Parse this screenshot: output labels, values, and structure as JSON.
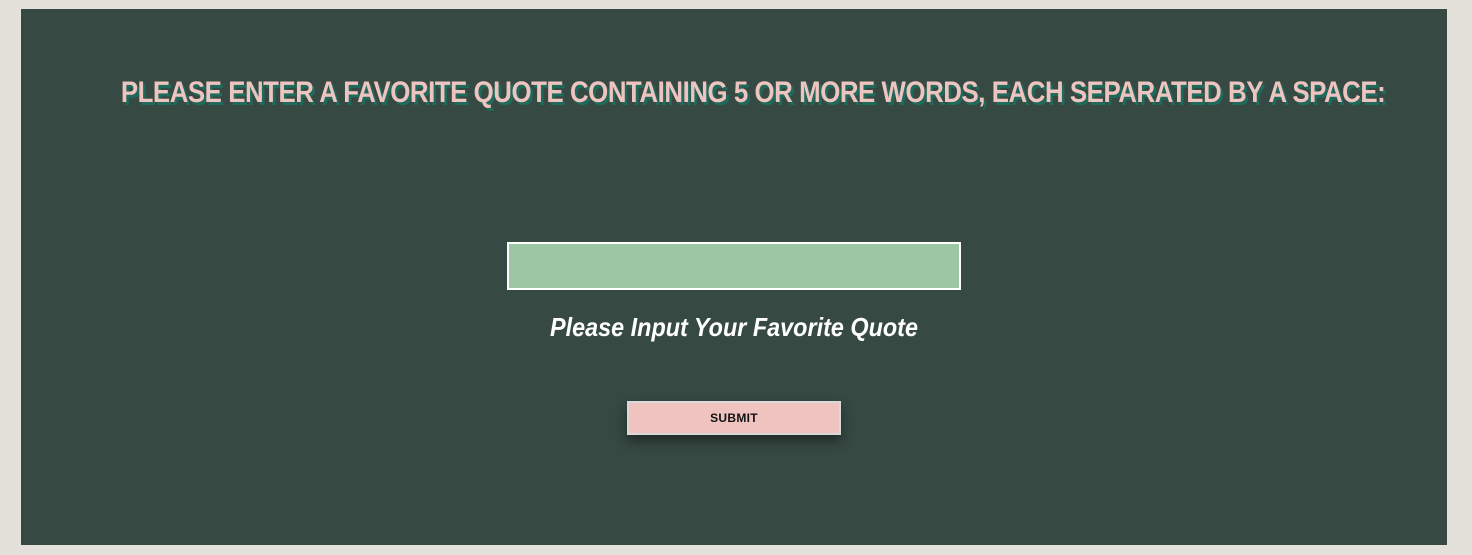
{
  "page": {
    "heading": "PLEASE ENTER A FAVORITE QUOTE CONTAINING 5 OR MORE WORDS, EACH SEPARATED BY A SPACE:",
    "input_value": "",
    "input_label": "Please Input Your Favorite Quote",
    "submit_label": "SUBMIT"
  },
  "colors": {
    "page_background": "#e4e0da",
    "panel_background": "#374943",
    "heading_text": "#eec4c0",
    "heading_shadow": "#1f6b5b",
    "input_background": "#9dc6a2",
    "label_text": "#ffffff",
    "button_background": "#efc3bf"
  }
}
